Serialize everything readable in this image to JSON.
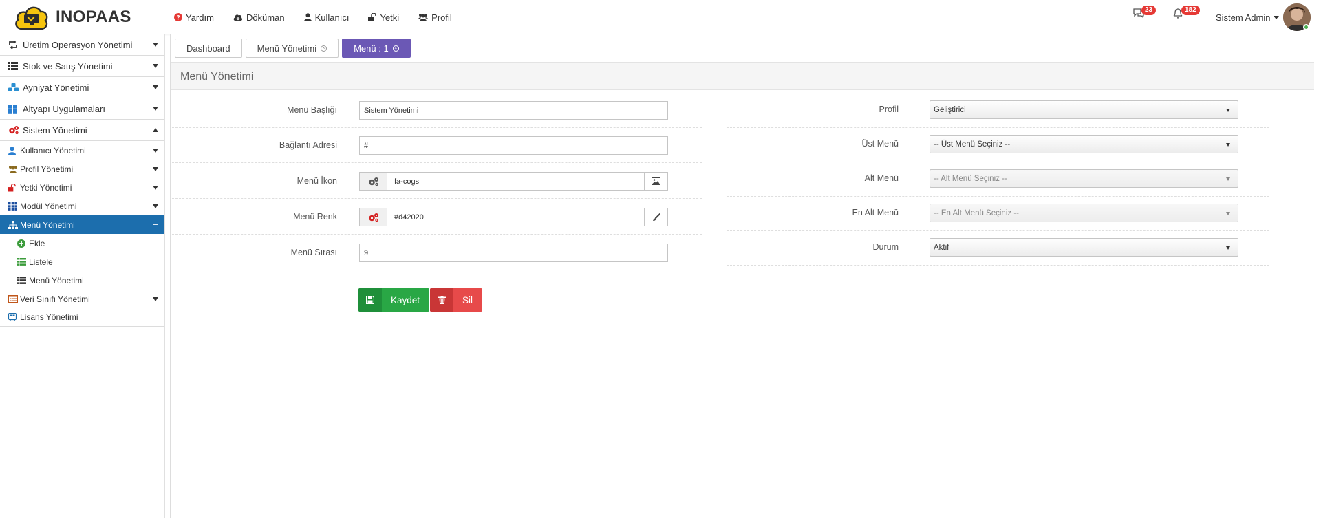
{
  "brand": {
    "name": "INOPAAS"
  },
  "topnav": [
    {
      "label": "Yardım",
      "icon": "question-circle-icon",
      "color": "#e53935"
    },
    {
      "label": "Döküman",
      "icon": "cloud-download-icon"
    },
    {
      "label": "Kullanıcı",
      "icon": "user-icon"
    },
    {
      "label": "Yetki",
      "icon": "unlock-icon"
    },
    {
      "label": "Profil",
      "icon": "users-icon"
    }
  ],
  "notifications": {
    "messages_count": "23",
    "alerts_count": "182",
    "badge_color": "#e53935"
  },
  "user": {
    "name": "Sistem Admin",
    "status_color": "#4caf50"
  },
  "sidebar": {
    "items": [
      {
        "label": "Üretim Operasyon Yönetimi",
        "icon": "retweet-icon"
      },
      {
        "label": "Stok ve Satış Yönetimi",
        "icon": "list-icon"
      },
      {
        "label": "Ayniyat Yönetimi",
        "icon": "cubes-icon"
      },
      {
        "label": "Altyapı Uygulamaları",
        "icon": "th-large-icon"
      },
      {
        "label": "Sistem Yönetimi",
        "icon": "cogs-icon",
        "expanded": true
      }
    ],
    "sub": [
      {
        "label": "Kullanıcı Yönetimi",
        "icon": "user-icon"
      },
      {
        "label": "Profil Yönetimi",
        "icon": "users-icon"
      },
      {
        "label": "Yetki Yönetimi",
        "icon": "unlock-icon"
      },
      {
        "label": "Modül Yönetimi",
        "icon": "th-icon"
      },
      {
        "label": "Menü Yönetimi",
        "icon": "sitemap-icon",
        "active": true
      }
    ],
    "sub3": [
      {
        "label": "Ekle",
        "icon": "plus-circle-icon"
      },
      {
        "label": "Listele",
        "icon": "list-icon"
      },
      {
        "label": "Menü Yönetimi",
        "icon": "list-ul-icon"
      }
    ],
    "sub_after": [
      {
        "label": "Veri Sınıfı Yönetimi",
        "icon": "list-alt-icon"
      },
      {
        "label": "Lisans Yönetimi",
        "icon": "server-icon"
      }
    ],
    "active_color": "#1c6ead"
  },
  "tabs": [
    {
      "label": "Dashboard"
    },
    {
      "label": "Menü Yönetimi",
      "closable": true
    },
    {
      "label": "Menü : 1",
      "closable": true,
      "active": true
    }
  ],
  "tab_active_color": "#6b58b5",
  "page": {
    "title": "Menü Yönetimi"
  },
  "form_left": {
    "title_label": "Menü Başlığı",
    "title_value": "Sistem Yönetimi",
    "url_label": "Bağlantı Adresi",
    "url_value": "#",
    "icon_label": "Menü İkon",
    "icon_value": "fa-cogs",
    "color_label": "Menü Renk",
    "color_value": "#d42020",
    "order_label": "Menü Sırası",
    "order_value": "9"
  },
  "form_right": {
    "profile_label": "Profil",
    "profile_value": "Geliştirici",
    "parent_label": "Üst Menü",
    "parent_value": "-- Üst Menü Seçiniz --",
    "child_label": "Alt Menü",
    "child_value": "-- Alt Menü Seçiniz --",
    "leaf_label": "En Alt Menü",
    "leaf_value": "-- En Alt Menü Seçiniz --",
    "status_label": "Durum",
    "status_value": "Aktif"
  },
  "buttons": {
    "save_label": "Kaydet",
    "save_color": "#29a745",
    "delete_label": "Sil",
    "delete_color": "#e74a4a"
  }
}
